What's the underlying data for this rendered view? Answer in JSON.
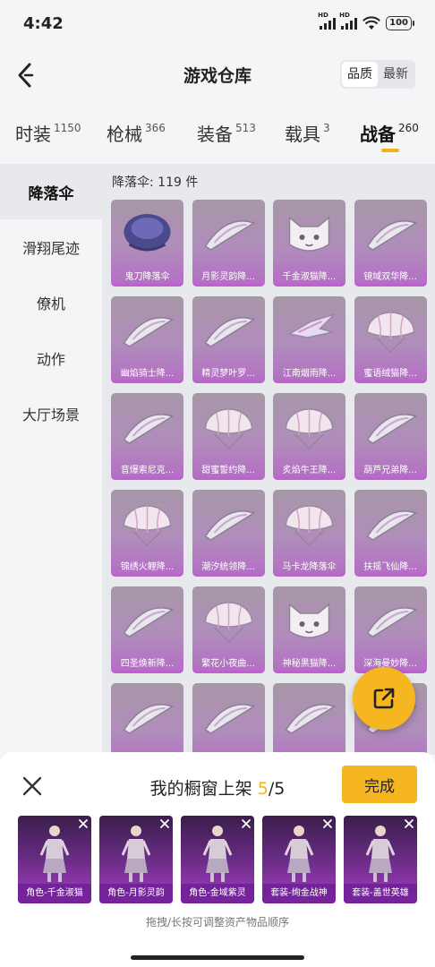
{
  "status_bar": {
    "time": "4:42",
    "network_tag": "HD",
    "battery": "100"
  },
  "header": {
    "title": "游戏仓库",
    "sort_options": [
      "品质",
      "最新"
    ],
    "sort_selected": "品质"
  },
  "tabs": [
    {
      "label": "时装",
      "count": "1150"
    },
    {
      "label": "枪械",
      "count": "366"
    },
    {
      "label": "装备",
      "count": "513"
    },
    {
      "label": "载具",
      "count": "3"
    },
    {
      "label": "战备",
      "count": "260",
      "active": true
    }
  ],
  "sidebar": {
    "items": [
      "降落伞",
      "滑翔尾迹",
      "僚机",
      "动作",
      "大厅场景"
    ],
    "active": "降落伞"
  },
  "content": {
    "count_label": "降落伞: 119 件",
    "items": [
      {
        "name": "鬼刀降落伞",
        "icon": "parachute-dark-icon"
      },
      {
        "name": "月影灵韵降...",
        "icon": "glider-icon"
      },
      {
        "name": "千金淑猫降...",
        "icon": "cat-parachute-icon"
      },
      {
        "name": "镜域双华降...",
        "icon": "glider-icon"
      },
      {
        "name": "幽焰骑士降...",
        "icon": "glider-icon"
      },
      {
        "name": "精灵梦叶罗...",
        "icon": "glider-icon"
      },
      {
        "name": "江南烟雨降...",
        "icon": "wing-glider-icon"
      },
      {
        "name": "蜜语绒猫降...",
        "icon": "round-parachute-icon"
      },
      {
        "name": "音爆索尼克...",
        "icon": "glider-icon"
      },
      {
        "name": "甜蜜誓约降...",
        "icon": "round-parachute-icon"
      },
      {
        "name": "炙焰牛王降...",
        "icon": "round-parachute-icon"
      },
      {
        "name": "葫芦兄弟降...",
        "icon": "glider-icon"
      },
      {
        "name": "锦绣火鲤降...",
        "icon": "round-parachute-icon"
      },
      {
        "name": "潮汐统领降...",
        "icon": "glider-icon"
      },
      {
        "name": "马卡龙降落伞",
        "icon": "round-parachute-icon"
      },
      {
        "name": "扶摇飞仙降...",
        "icon": "glider-icon"
      },
      {
        "name": "四圣焕新降...",
        "icon": "glider-icon"
      },
      {
        "name": "繁花小夜曲...",
        "icon": "round-parachute-icon"
      },
      {
        "name": "神秘黑猫降...",
        "icon": "cat-parachute-icon"
      },
      {
        "name": "深海曼妙降...",
        "icon": "glider-icon"
      },
      {
        "name": "",
        "icon": "glider-icon"
      },
      {
        "name": "",
        "icon": "glider-icon"
      },
      {
        "name": "",
        "icon": "glider-icon"
      },
      {
        "name": "",
        "icon": "glider-icon"
      }
    ]
  },
  "share_button": {
    "icon": "share-external-icon"
  },
  "showcase": {
    "title": "我的橱窗上架",
    "current": "5",
    "total": "/5",
    "done_label": "完成",
    "slots": [
      "角色-千金淑猫",
      "角色-月影灵韵",
      "角色-金域紫灵",
      "套装-绚金战神",
      "套装-盖世英雄"
    ],
    "hint": "拖拽/长按可调整资产物品顺序"
  },
  "colors": {
    "accent": "#f6b620",
    "card_purple": "#b56cc5",
    "slot_purple": "#6a2c86"
  }
}
